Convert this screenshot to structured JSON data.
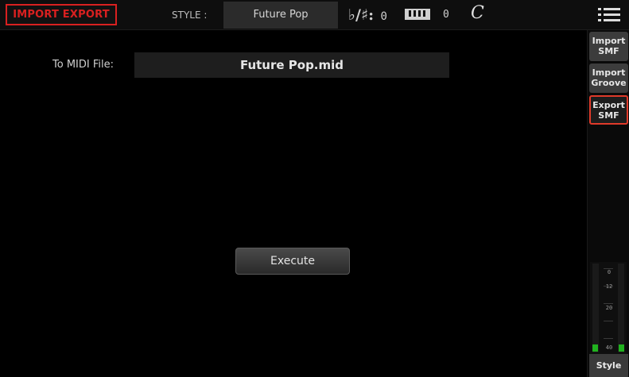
{
  "header": {
    "page_title": "IMPORT EXPORT",
    "style_label": "STYLE :",
    "style_name": "Future Pop",
    "transpose_symbol": "♭/♯:",
    "transpose_value": "0",
    "octave_value": "0",
    "lock_symbol": "C",
    "menu_icon": "hamburger-menu-icon"
  },
  "main": {
    "midi_file_label": "To MIDI File:",
    "midi_file_value": "Future Pop.mid",
    "execute_label": "Execute"
  },
  "sidebar": {
    "tabs": [
      {
        "line1": "Import",
        "line2": "SMF",
        "active": false
      },
      {
        "line1": "Import",
        "line2": "Groove",
        "active": false
      },
      {
        "line1": "Export",
        "line2": "SMF",
        "active": true
      }
    ],
    "meter_marks": [
      "0",
      "12",
      "20",
      "40"
    ],
    "style_button": "Style"
  },
  "colors": {
    "accent_red": "#d92020",
    "meter_green": "#21b21f",
    "background": "#000000"
  }
}
